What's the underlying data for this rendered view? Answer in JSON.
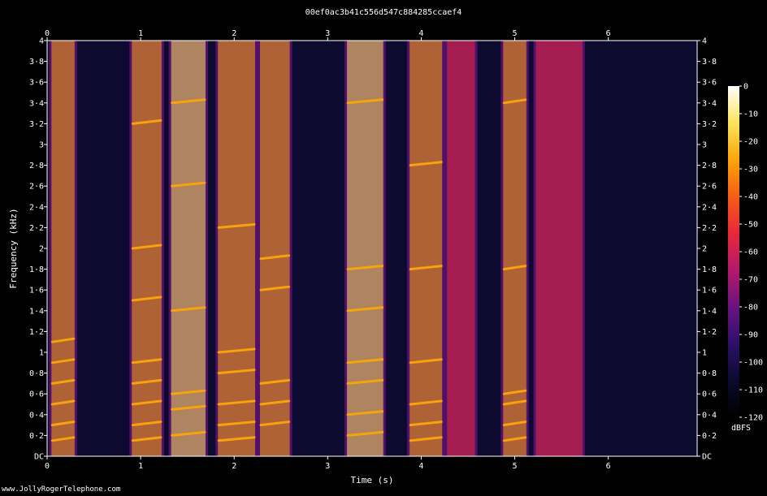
{
  "title": "00ef0ac3b41c556d547c884285ccaef4",
  "watermark": "www.JollyRogerTelephone.com",
  "colors": {
    "background": "#000000",
    "axis": "#ffffff",
    "colormap": [
      "#000000",
      "#0c0a2e",
      "#2d0f6b",
      "#6a1380",
      "#b3196a",
      "#e8283a",
      "#f65d15",
      "#fca50a",
      "#fbe45a",
      "#ffffff"
    ]
  },
  "chart_data": {
    "type": "heatmap",
    "subtype": "spectrogram",
    "title": "00ef0ac3b41c556d547c884285ccaef4",
    "xlabel": "Time (s)",
    "ylabel": "Frequency (kHz)",
    "xlim": [
      0,
      6.95
    ],
    "ylim": [
      0,
      4
    ],
    "x_ticks": [
      "0",
      "1",
      "2",
      "3",
      "4",
      "5",
      "6"
    ],
    "y_ticks": [
      "DC",
      "0·2",
      "0·4",
      "0·6",
      "0·8",
      "1",
      "1·2",
      "1·4",
      "1·6",
      "1·8",
      "2",
      "2·2",
      "2·4",
      "2·6",
      "2·8",
      "3",
      "3·2",
      "3·4",
      "3·6",
      "3·8",
      "4"
    ],
    "colorbar": {
      "label": "dBFS",
      "range": [
        -120,
        0
      ],
      "ticks": [
        "0",
        "-10",
        "-20",
        "-30",
        "-40",
        "-50",
        "-60",
        "-70",
        "-80",
        "-90",
        "-100",
        "-110",
        "-120"
      ]
    },
    "grid": false,
    "voiced_segments": [
      {
        "start": 0.02,
        "end": 0.32,
        "level_db": -30
      },
      {
        "start": 0.88,
        "end": 1.25,
        "level_db": -25
      },
      {
        "start": 1.3,
        "end": 1.72,
        "level_db": -20
      },
      {
        "start": 1.8,
        "end": 2.25,
        "level_db": -25
      },
      {
        "start": 2.25,
        "end": 2.62,
        "level_db": -30
      },
      {
        "start": 3.18,
        "end": 3.62,
        "level_db": -20
      },
      {
        "start": 3.85,
        "end": 4.25,
        "level_db": -25
      },
      {
        "start": 4.25,
        "end": 4.6,
        "level_db": -55
      },
      {
        "start": 4.85,
        "end": 5.15,
        "level_db": -25
      },
      {
        "start": 5.2,
        "end": 5.75,
        "level_db": -55
      }
    ],
    "formant_tracks": [
      {
        "segment": 0,
        "freqs_khz": [
          0.15,
          0.3,
          0.5,
          0.7,
          0.9,
          1.1
        ]
      },
      {
        "segment": 1,
        "freqs_khz": [
          0.15,
          0.3,
          0.5,
          0.7,
          0.9,
          1.5,
          2.0,
          3.2
        ]
      },
      {
        "segment": 2,
        "freqs_khz": [
          0.2,
          0.45,
          0.6,
          1.4,
          2.6,
          3.4
        ]
      },
      {
        "segment": 3,
        "freqs_khz": [
          0.15,
          0.3,
          0.5,
          0.8,
          1.0,
          2.2
        ]
      },
      {
        "segment": 4,
        "freqs_khz": [
          0.3,
          0.5,
          0.7,
          1.6,
          1.9
        ]
      },
      {
        "segment": 5,
        "freqs_khz": [
          0.2,
          0.4,
          0.7,
          0.9,
          1.4,
          1.8,
          3.4
        ]
      },
      {
        "segment": 6,
        "freqs_khz": [
          0.15,
          0.3,
          0.5,
          0.9,
          1.8,
          2.8
        ]
      },
      {
        "segment": 8,
        "freqs_khz": [
          0.15,
          0.3,
          0.5,
          0.6,
          1.8,
          3.4
        ]
      }
    ]
  }
}
